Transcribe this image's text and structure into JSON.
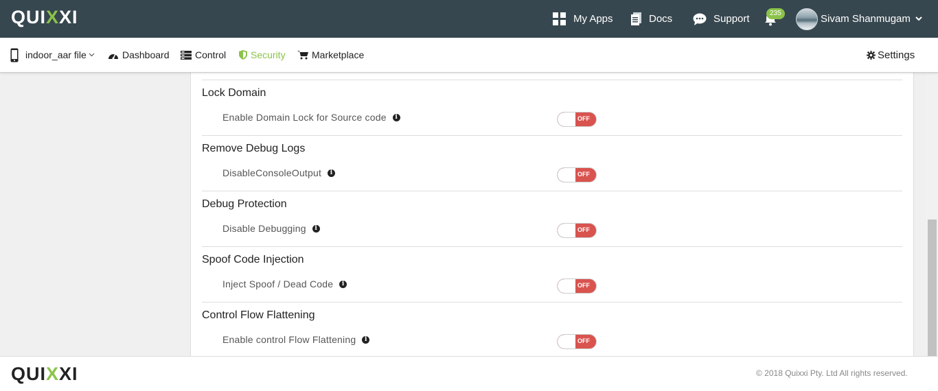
{
  "app": {
    "logo_left": "QUI",
    "logo_x1": "X",
    "logo_x2": "X",
    "logo_right": "I"
  },
  "topnav": {
    "my_apps": "My Apps",
    "docs": "Docs",
    "support": "Support",
    "notifications_count": "235",
    "user_name": "Sivam Shanmugam"
  },
  "subnav": {
    "file": "indoor_aar file",
    "dashboard": "Dashboard",
    "control": "Control",
    "security": "Security",
    "marketplace": "Marketplace",
    "settings": "Settings"
  },
  "sections": [
    {
      "title": "Lock Domain",
      "label": "Enable Domain Lock for Source code",
      "state": "OFF"
    },
    {
      "title": "Remove Debug Logs",
      "label": "DisableConsoleOutput",
      "state": "OFF"
    },
    {
      "title": "Debug Protection",
      "label": "Disable Debugging",
      "state": "OFF"
    },
    {
      "title": "Spoof Code Injection",
      "label": "Inject Spoof / Dead Code",
      "state": "OFF"
    },
    {
      "title": "Control Flow Flattening",
      "label": "Enable control Flow Flattening",
      "state": "OFF"
    }
  ],
  "footer": {
    "copyright": "© 2018 Quixxi Pty. Ltd All rights reserved."
  },
  "colors": {
    "accent": "#8bc34a",
    "topbar": "#37474f",
    "toggle_off": "#d9534f"
  }
}
